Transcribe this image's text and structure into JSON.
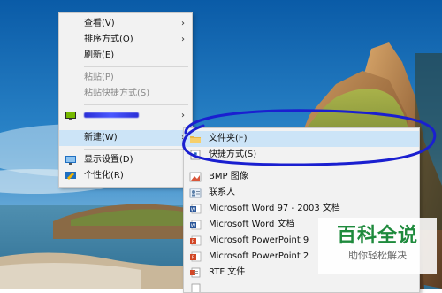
{
  "context_menu": {
    "items": [
      {
        "label": "查看(V)",
        "submenu": true
      },
      {
        "label": "排序方式(O)",
        "submenu": true
      },
      {
        "label": "刷新(E)"
      },
      {
        "label": "粘贴(P)",
        "disabled": true
      },
      {
        "label": "粘贴快捷方式(S)",
        "disabled": true
      },
      {
        "label": "",
        "icon": "nvidia-icon",
        "submenu": true,
        "redacted": true
      },
      {
        "label": "新建(W)",
        "submenu": true,
        "highlighted": true
      },
      {
        "label": "显示设置(D)",
        "icon": "display-settings-icon"
      },
      {
        "label": "个性化(R)",
        "icon": "personalize-icon"
      }
    ]
  },
  "new_submenu": {
    "items": [
      {
        "label": "文件夹(F)",
        "icon": "folder-icon",
        "highlighted": true
      },
      {
        "label": "快捷方式(S)",
        "icon": "shortcut-icon"
      },
      {
        "label": "BMP 图像",
        "icon": "bmp-image-icon"
      },
      {
        "label": "联系人",
        "icon": "contact-icon"
      },
      {
        "label": "Microsoft Word 97 - 2003 文档",
        "icon": "word-icon"
      },
      {
        "label": "Microsoft Word 文档",
        "icon": "word-icon"
      },
      {
        "label": "Microsoft PowerPoint 9",
        "icon": "powerpoint-icon"
      },
      {
        "label": "Microsoft PowerPoint 2",
        "icon": "powerpoint-icon"
      },
      {
        "label": "RTF 文件",
        "icon": "rtf-icon"
      }
    ]
  },
  "watermark": {
    "title": "百科全说",
    "subtitle": "助你轻松解决"
  },
  "colors": {
    "highlight": "#cce4f7",
    "annotation": "#1a1fd0",
    "watermark_green": "#1e8a3c"
  }
}
